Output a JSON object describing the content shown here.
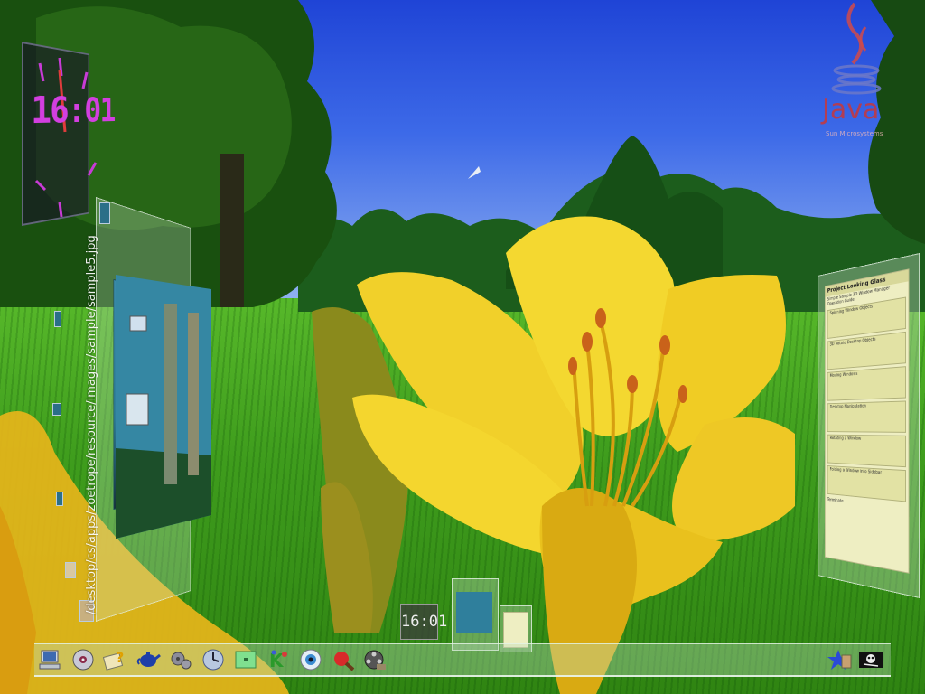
{
  "desktop": {
    "clock_time": "16:01",
    "viewer_path": "/desktop/cs/apps/zoetrope/resource/images/sample/sample5.jpg",
    "logo": {
      "word": "Java",
      "sub": "Sun Microsystems"
    },
    "guide": {
      "title": "Project Looking Glass",
      "subtitle": "Simple Sample 3D Window Manager Operation Guide",
      "sections": [
        "Spinning Window Objects",
        "3D Rotate Desktop Objects",
        "Moving Windows",
        "Desktop Manipulation",
        "Rotating a Window",
        "Folding a Window into Sidebar",
        "Terminate"
      ]
    }
  },
  "bottom": {
    "mini_clock": "16:01"
  },
  "taskbar": {
    "icons": [
      "computer-icon",
      "cd-icon",
      "help-icon",
      "teapot-icon",
      "gear-icon",
      "clock-icon",
      "panel-icon",
      "kdraw-icon",
      "eye-icon",
      "paddle-icon",
      "film-icon"
    ],
    "right_icons": [
      "sun-icon",
      "skull-icon"
    ]
  },
  "colors": {
    "sky": "#2f55e0",
    "grass": "#3f9d1d",
    "lily": "#f2d21e",
    "clock_digits": "#d33fe0",
    "java_red": "#c8373a"
  }
}
